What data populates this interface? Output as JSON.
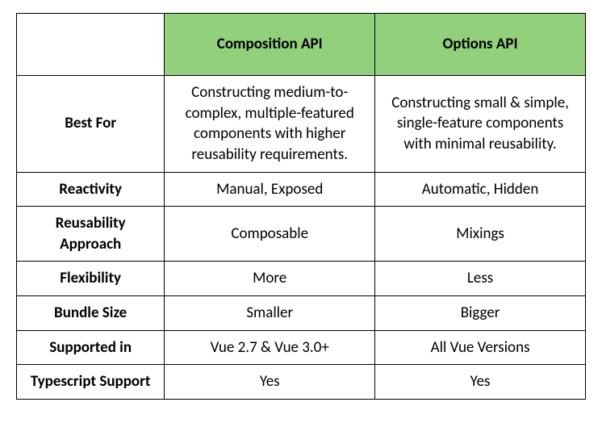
{
  "chart_data": {
    "type": "table",
    "columns": [
      "",
      "Composition API",
      "Options API"
    ],
    "rows": [
      [
        "Best For",
        "Constructing medium-to-complex, multiple-featured components with higher reusability requirements.",
        "Constructing small & simple, single-feature components with minimal reusability."
      ],
      [
        "Reactivity",
        "Manual, Exposed",
        "Automatic, Hidden"
      ],
      [
        "Reusability Approach",
        "Composable",
        "Mixings"
      ],
      [
        "Flexibility",
        "More",
        "Less"
      ],
      [
        "Bundle Size",
        "Smaller",
        "Bigger"
      ],
      [
        "Supported in",
        "Vue 2.7 & Vue 3.0+",
        "All Vue Versions"
      ],
      [
        "Typescript Support",
        "Yes",
        "Yes"
      ]
    ]
  },
  "colors": {
    "header_bg": "#93d07c"
  },
  "table": {
    "headers": {
      "col1": "Composition API",
      "col2": "Options API"
    },
    "rows": [
      {
        "label": "Best For",
        "c1": "Constructing medium-to-complex, multiple-featured components with higher reusability requirements.",
        "c2": "Constructing small & simple, single-feature components with minimal reusability."
      },
      {
        "label": "Reactivity",
        "c1": "Manual, Exposed",
        "c2": "Automatic, Hidden"
      },
      {
        "label": "Reusability Approach",
        "c1": "Composable",
        "c2": "Mixings"
      },
      {
        "label": "Flexibility",
        "c1": "More",
        "c2": "Less"
      },
      {
        "label": "Bundle Size",
        "c1": "Smaller",
        "c2": "Bigger"
      },
      {
        "label": "Supported in",
        "c1": "Vue 2.7 & Vue 3.0+",
        "c2": "All Vue Versions"
      },
      {
        "label": "Typescript Support",
        "c1": "Yes",
        "c2": "Yes"
      }
    ]
  }
}
